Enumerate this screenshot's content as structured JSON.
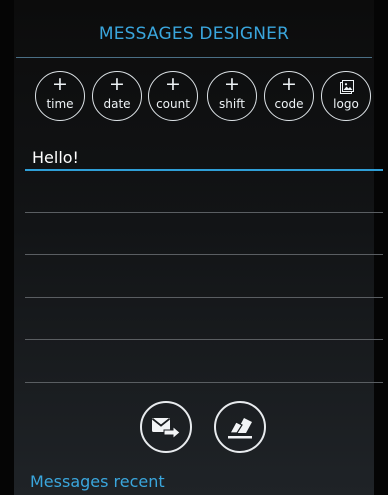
{
  "header": {
    "title": "MESSAGES DESIGNER"
  },
  "insert_buttons": [
    {
      "symbol": "+",
      "label": "time",
      "icon": "plus-icon"
    },
    {
      "symbol": "+",
      "label": "date",
      "icon": "plus-icon"
    },
    {
      "symbol": "+",
      "label": "count",
      "icon": "plus-icon"
    },
    {
      "symbol": "+",
      "label": "shift",
      "icon": "plus-icon"
    },
    {
      "symbol": "+",
      "label": "code",
      "icon": "plus-icon"
    },
    {
      "symbol": "",
      "label": "logo",
      "icon": "image-icon"
    }
  ],
  "editor": {
    "value": "Hello!",
    "placeholder": ""
  },
  "actions": {
    "send_icon": "send-message-icon",
    "clear_icon": "eraser-icon"
  },
  "recent": {
    "label": "Messages recent"
  },
  "colors": {
    "accent": "#3aa6dd",
    "background": "#121416",
    "text": "#ffffff"
  }
}
